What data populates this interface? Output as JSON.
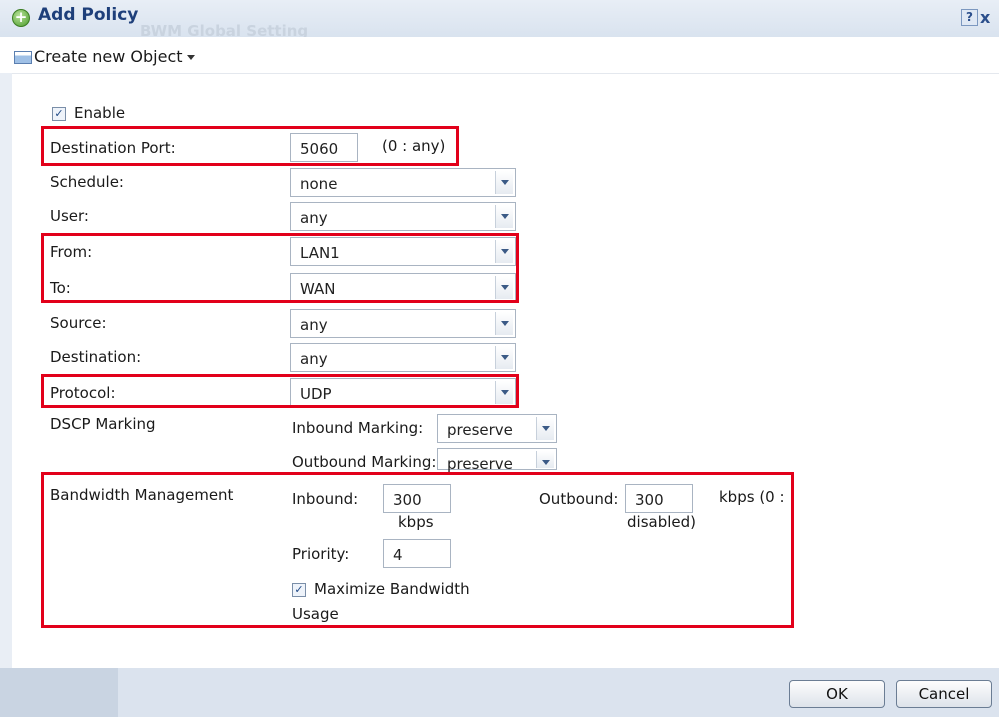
{
  "window": {
    "title": "Add Policy",
    "background_title": "BWM Global Setting",
    "help_label": "?",
    "close_label": "x"
  },
  "toolbar": {
    "create_label": "Create new Object"
  },
  "form": {
    "enable_label": "Enable",
    "enable_checked": true,
    "destination_port": {
      "label": "Destination Port:",
      "value": "5060",
      "hint": "(0 : any)"
    },
    "schedule": {
      "label": "Schedule:",
      "value": "none"
    },
    "user": {
      "label": "User:",
      "value": "any"
    },
    "from": {
      "label": "From:",
      "value": "LAN1"
    },
    "to": {
      "label": "To:",
      "value": "WAN"
    },
    "source": {
      "label": "Source:",
      "value": "any"
    },
    "destination": {
      "label": "Destination:",
      "value": "any"
    },
    "protocol": {
      "label": "Protocol:",
      "value": "UDP"
    },
    "dscp": {
      "label": "DSCP Marking",
      "inbound_label": "Inbound Marking:",
      "inbound_value": "preserve",
      "outbound_label": "Outbound Marking:",
      "outbound_value": "preserve"
    },
    "bandwidth": {
      "label": "Bandwidth Management",
      "inbound_label": "Inbound:",
      "inbound_value": "300",
      "inbound_unit": "kbps",
      "outbound_label": "Outbound:",
      "outbound_value": "300",
      "outbound_unit_1": "kbps (0 :",
      "outbound_unit_2": "disabled)",
      "priority_label": "Priority:",
      "priority_value": "4",
      "maximize_label_1": "Maximize Bandwidth",
      "maximize_label_2": "Usage",
      "maximize_checked": true
    }
  },
  "buttons": {
    "ok": "OK",
    "cancel": "Cancel"
  },
  "colors": {
    "highlight": "#e2001a",
    "title_text": "#1e3f7a"
  }
}
